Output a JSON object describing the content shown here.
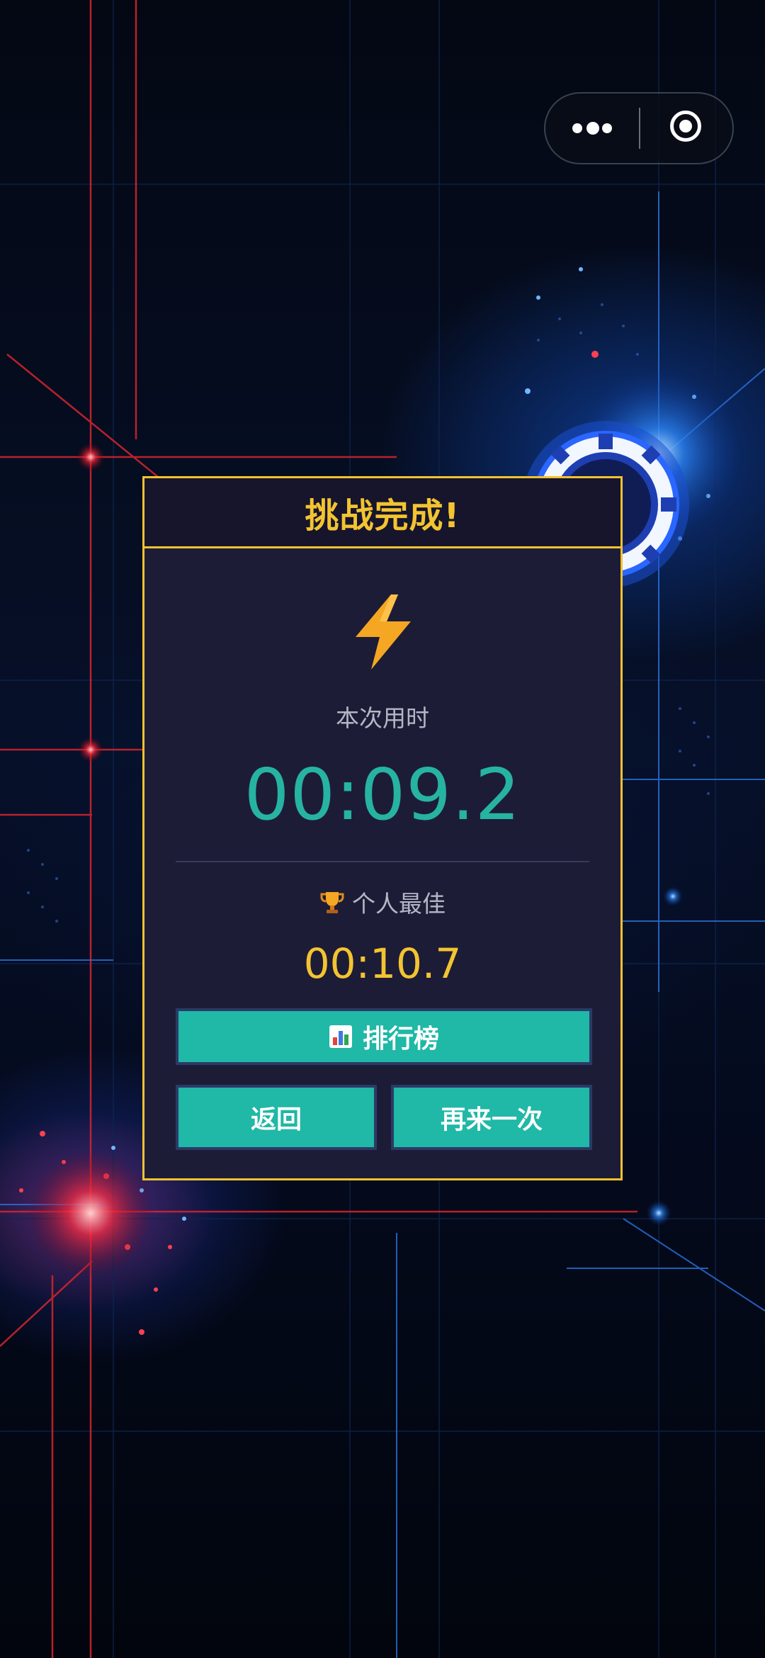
{
  "capsule": {
    "more_icon": "more-dots-icon",
    "close_icon": "target-circle-icon"
  },
  "dialog": {
    "title": "挑战完成!",
    "icon": "lightning-bolt-icon",
    "time_label": "本次用时",
    "time_value": "00:09.2",
    "best_icon": "trophy-icon",
    "best_label": "个人最佳",
    "best_value": "00:10.7",
    "rank_icon": "bar-chart-icon",
    "rank_button": "排行榜",
    "back_button": "返回",
    "retry_button": "再来一次"
  },
  "colors": {
    "accent_gold": "#f3c431",
    "accent_teal": "#20b8a6",
    "dialog_bg": "#1d1c36",
    "page_bg": "#040813"
  }
}
